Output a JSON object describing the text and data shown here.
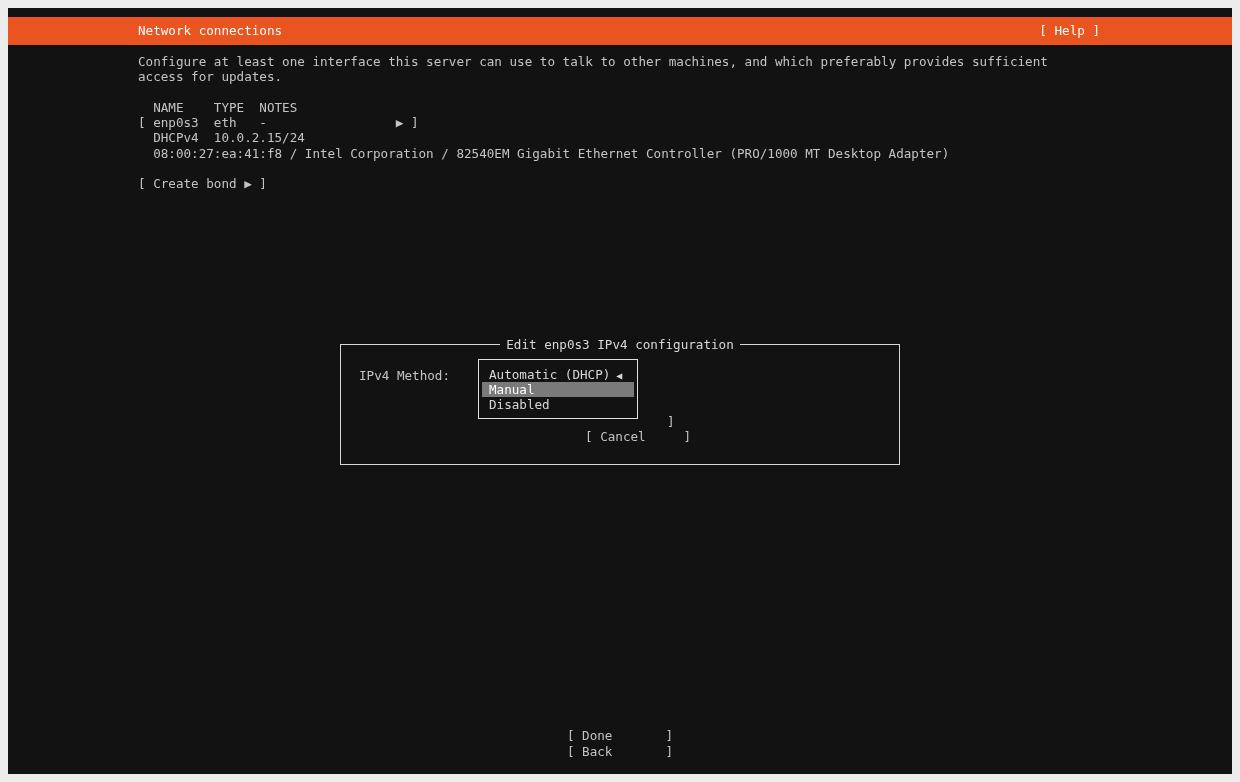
{
  "header": {
    "title": "Network connections",
    "help": "[ Help ]"
  },
  "intro": "Configure at least one interface this server can use to talk to other machines, and which preferably provides sufficient access for updates.",
  "table": {
    "columns": [
      "NAME",
      "TYPE",
      "NOTES"
    ],
    "interfaces": [
      {
        "open": "[",
        "name": "enp0s3",
        "type": "eth",
        "notes": "-",
        "close": "▶ ]",
        "details": [
          {
            "label": "DHCPv4",
            "value": "10.0.2.15/24"
          }
        ],
        "hardware": "08:00:27:ea:41:f8 / Intel Corporation / 82540EM Gigabit Ethernet Controller (PRO/1000 MT Desktop Adapter)"
      }
    ]
  },
  "create_bond": "[ Create bond ▶ ]",
  "dialog": {
    "title": "Edit enp0s3 IPv4 configuration",
    "field_label": "IPv4 Method:",
    "options": [
      {
        "label": "Automatic (DHCP)",
        "marker": "◀",
        "selected": false
      },
      {
        "label": "Manual",
        "selected": true
      },
      {
        "label": "Disabled",
        "selected": false
      }
    ],
    "hidden_button_edge": "]",
    "cancel": "[ Cancel     ]"
  },
  "buttons": [
    "[ Done       ]",
    "[ Back       ]"
  ]
}
